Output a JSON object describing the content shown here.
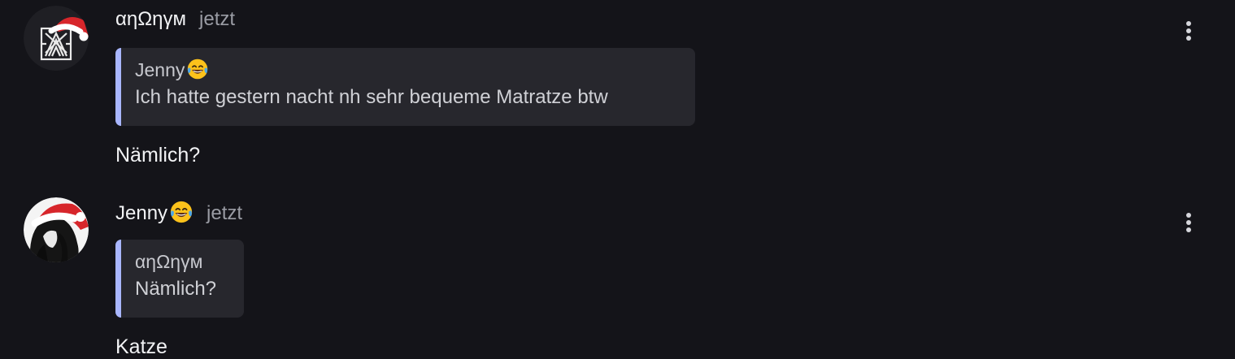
{
  "messages": [
    {
      "author": "αηΩηγм",
      "time": "jetzt",
      "avatar_icon": "maze-logo-with-santa-hat",
      "quote": {
        "author": "Jenny",
        "author_emoji": "face-with-tears-of-joy",
        "text": "Ich hatte gestern nacht nh sehr bequeme Matratze btw"
      },
      "text": "Nämlich?"
    },
    {
      "author": "Jenny",
      "author_emoji": "face-with-tears-of-joy",
      "time": "jetzt",
      "avatar_icon": "anime-girl-with-santa-hat",
      "quote": {
        "author": "αηΩηγм",
        "text": "Nämlich?"
      },
      "text": "Katze"
    }
  ],
  "colors": {
    "background": "#141419",
    "quote_background": "#27272d",
    "quote_bar": "#a9b6ff",
    "santa_red": "#d7262b"
  }
}
